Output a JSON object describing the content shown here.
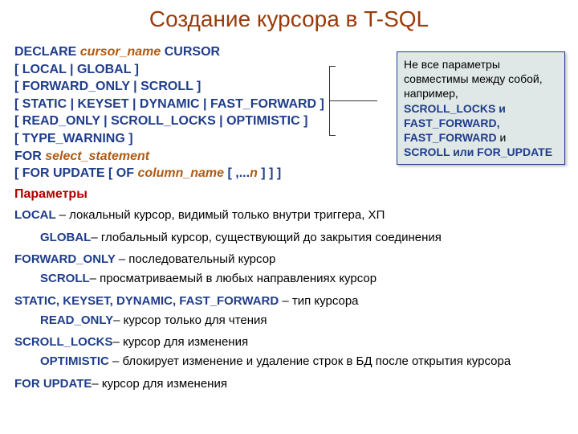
{
  "title": "Создание курсора в T-SQL",
  "syntax": {
    "l1a": "DECLARE ",
    "l1b": "cursor_name",
    "l1c": " CURSOR",
    "l2": "[ LOCAL | GLOBAL ]",
    "l3": "[ FORWARD_ONLY | SCROLL ]",
    "l4": "[ STATIC | KEYSET | DYNAMIC | FAST_FORWARD ]",
    "l5": "[ READ_ONLY | SCROLL_LOCKS | OPTIMISTIC ]",
    "l6": "[ TYPE_WARNING ]",
    "l7a": "FOR ",
    "l7b": "select_statement",
    "l8a": "[ FOR UPDATE [ OF ",
    "l8b": "column_name",
    "l8c": " [ ,...",
    "l8d": "n",
    "l8e": " ] ] ]"
  },
  "params_heading": "Параметры",
  "params": {
    "local_lbl": "LOCAL ",
    "local_txt": "– локальный курсор, видимый только внутри триггера, ХП",
    "global_lbl": "GLOBAL",
    "global_txt": "– глобальный курсор, существующий до закрытия соединения",
    "fwd_lbl": "FORWARD_ONLY ",
    "fwd_txt": "– последовательный курсор",
    "scroll_lbl": "SCROLL",
    "scroll_txt": "– просматриваемый в любых направлениях  курсор",
    "type_lbl": "STATIC, KEYSET, DYNAMIC, FAST_FORWARD ",
    "type_txt": "– тип  курсора",
    "ro_lbl": "READ_ONLY",
    "ro_txt": "– курсор только для чтения",
    "sl_lbl": "SCROLL_LOCKS",
    "sl_txt": "– курсор для изменения",
    "opt_lbl": "OPTIMISTIC ",
    "opt_txt": "– блокирует изменение и удаление строк в БД после открытия курсора",
    "fu_lbl": "FOR UPDATE",
    "fu_txt": "– курсор для изменения"
  },
  "note": {
    "t1": "Не все параметры совместимы между собой, например,",
    "k1": "SCROLL_LOCKS и FAST_FORWARD,",
    "k2a": "FAST_FORWARD ",
    "k2b": " и",
    "k3": "SCROLL или FOR_UPDATE"
  }
}
